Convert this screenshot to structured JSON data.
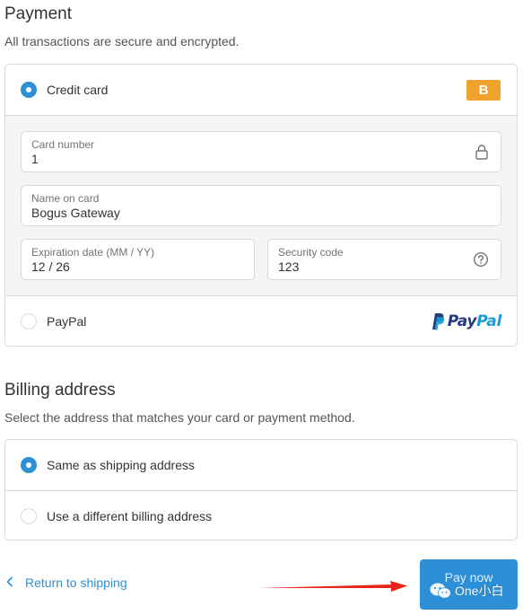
{
  "payment": {
    "title": "Payment",
    "subtitle": "All transactions are secure and encrypted.",
    "methods": [
      {
        "label": "Credit card",
        "selected": true,
        "badge": "B",
        "badge_color": "#f0a22d"
      },
      {
        "label": "PayPal",
        "selected": false
      }
    ],
    "paypal_logo": {
      "part1": "Pay",
      "part2": "Pal"
    },
    "card_fields": {
      "number": {
        "label": "Card number",
        "value": "1",
        "icon": "lock-icon"
      },
      "name": {
        "label": "Name on card",
        "value": "Bogus Gateway"
      },
      "expiry": {
        "label": "Expiration date (MM / YY)",
        "value": "12 / 26"
      },
      "security": {
        "label": "Security code",
        "value": "123",
        "icon": "help-circle-icon"
      }
    }
  },
  "billing": {
    "title": "Billing address",
    "subtitle": "Select the address that matches your card or payment method.",
    "options": [
      {
        "label": "Same as shipping address",
        "selected": true
      },
      {
        "label": "Use a different billing address",
        "selected": false
      }
    ]
  },
  "footer": {
    "return_label": "Return to shipping",
    "pay_label": "Pay now"
  },
  "watermark": {
    "text": "One小白"
  },
  "colors": {
    "accent": "#2d8fd5",
    "border": "#d9d9d9",
    "panel": "#f5f5f5",
    "annotation_arrow": "#e8251b"
  }
}
